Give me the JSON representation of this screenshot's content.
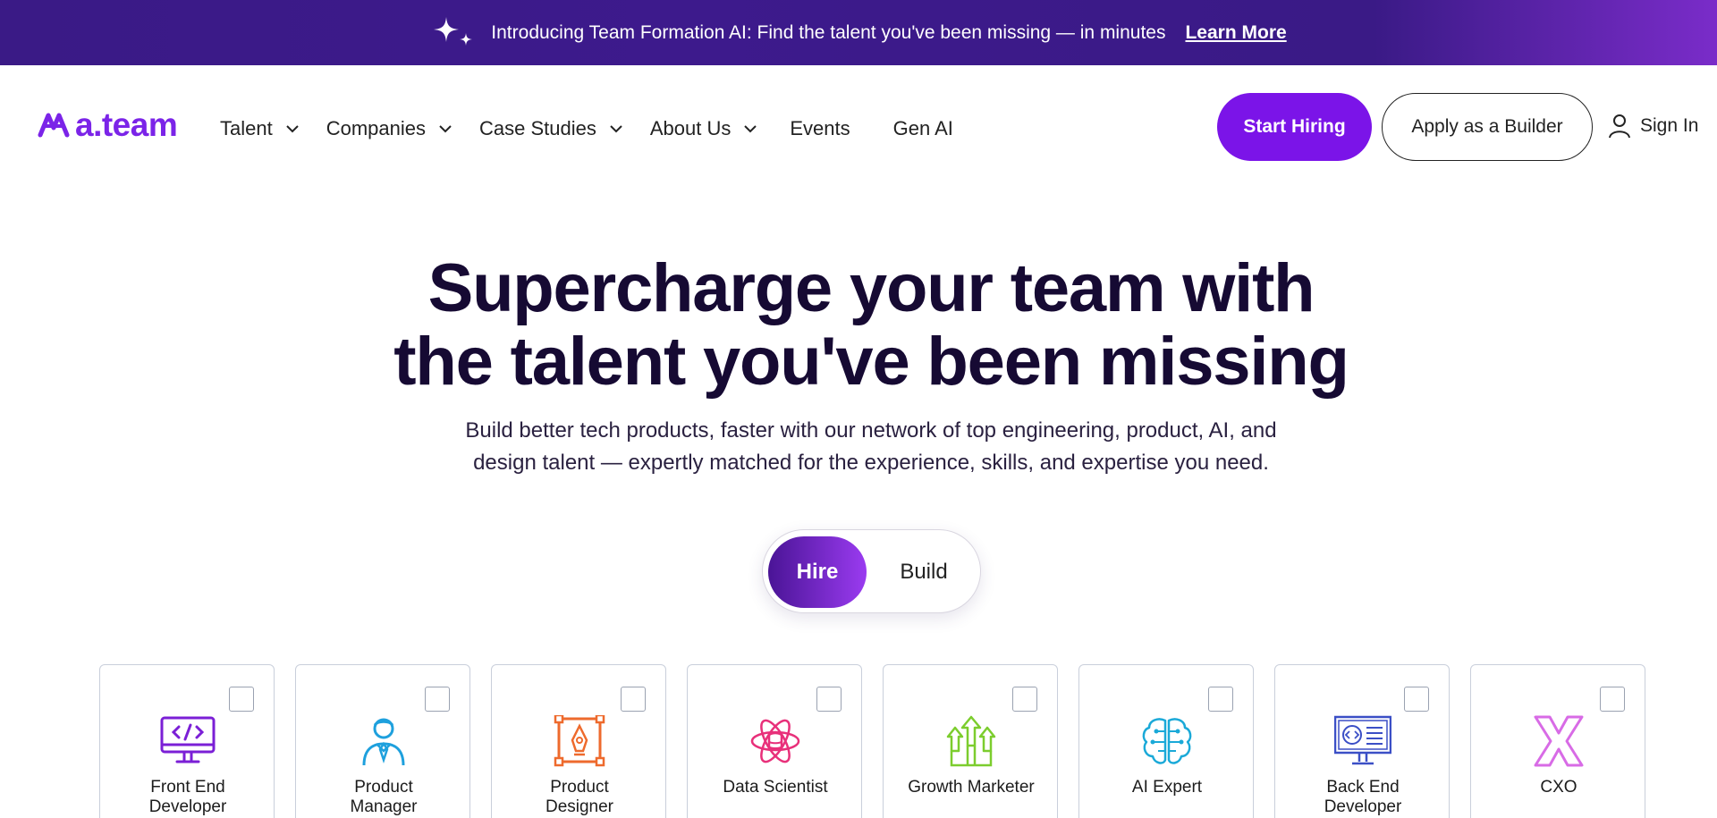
{
  "announcement": {
    "text": "Introducing Team Formation AI: Find the talent you've been missing — in minutes",
    "link": "Learn More",
    "icon": "sparkle-icon"
  },
  "nav": {
    "logo": "a.team",
    "items": [
      {
        "label": "Talent",
        "dropdown": true
      },
      {
        "label": "Companies",
        "dropdown": true
      },
      {
        "label": "Case Studies",
        "dropdown": true
      },
      {
        "label": "About Us",
        "dropdown": true
      },
      {
        "label": "Events",
        "dropdown": false
      },
      {
        "label": "Gen AI",
        "dropdown": false
      }
    ],
    "start_hiring": "Start Hiring",
    "apply": "Apply as a Builder",
    "sign_in": "Sign In"
  },
  "hero": {
    "title_line1": "Supercharge your team with",
    "title_line2": "the talent you've been missing",
    "sub_line1": "Build better tech products, faster with our network of top engineering, product, AI, and",
    "sub_line2": "design talent — expertly matched for the experience, skills, and expertise you need."
  },
  "toggle": {
    "options": [
      "Hire",
      "Build"
    ],
    "selected": "Hire"
  },
  "roles": [
    {
      "line1": "Front End",
      "line2": "Developer",
      "icon": "code-monitor-icon",
      "color": "#7b1fd6",
      "checked": false
    },
    {
      "line1": "Product",
      "line2": "Manager",
      "icon": "person-tie-icon",
      "color": "#1ea0dd",
      "checked": false
    },
    {
      "line1": "Product",
      "line2": "Designer",
      "icon": "pen-tool-icon",
      "color": "#ee6a2d",
      "checked": false
    },
    {
      "line1": "Data Scientist",
      "line2": "",
      "icon": "atom-database-icon",
      "color": "#e8307a",
      "checked": false
    },
    {
      "line1": "Growth Marketer",
      "line2": "",
      "icon": "growth-arrows-icon",
      "color": "#7ccd2e",
      "checked": false
    },
    {
      "line1": "AI Expert",
      "line2": "",
      "icon": "brain-circuit-icon",
      "color": "#1aa9d8",
      "checked": false
    },
    {
      "line1": "Back End",
      "line2": "Developer",
      "icon": "code-screen-icon",
      "color": "#3b4fc6",
      "checked": false
    },
    {
      "line1": "CXO",
      "line2": "",
      "icon": "x-letter-icon",
      "color": "#d86be6",
      "checked": false
    }
  ],
  "colors": {
    "brand": "#7b14e8",
    "banner": "#3a1a86",
    "heading": "#160a33"
  }
}
